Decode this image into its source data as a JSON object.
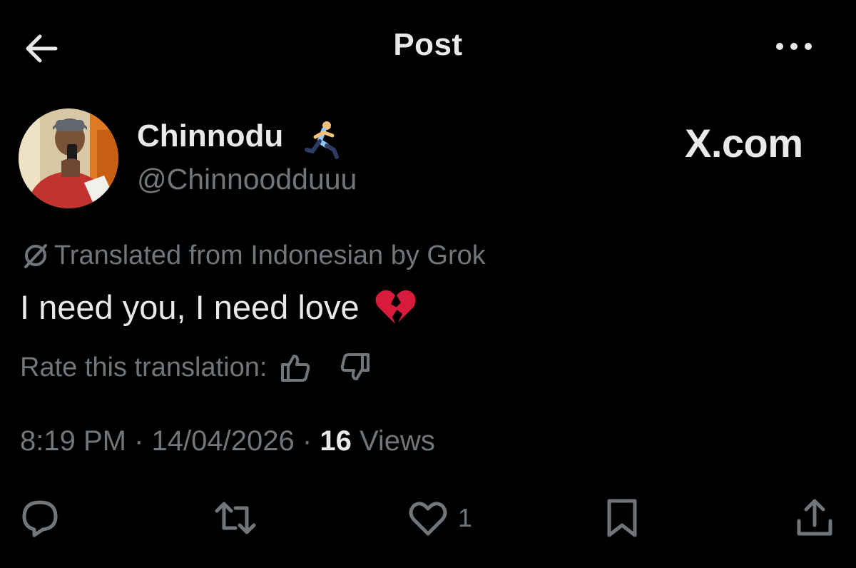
{
  "header": {
    "title": "Post",
    "back_icon": "arrow-left-icon",
    "more_icon": "more-horizontal-icon"
  },
  "author": {
    "display_name": "Chinnodu",
    "badge_emoji": "runner-emoji",
    "handle": "@Chinnoodduuu"
  },
  "watermark": "X.com",
  "translation": {
    "label": "Translated from Indonesian by Grok",
    "rate_label": "Rate this translation:"
  },
  "post": {
    "text": "I need you, I need love",
    "emoji": "broken-heart-emoji"
  },
  "meta": {
    "time": "8:19 PM",
    "separator": "·",
    "date": "14/04/2026",
    "views_count": "16",
    "views_label": "Views"
  },
  "actions": {
    "like_count": "1"
  },
  "colors": {
    "background": "#000000",
    "primary_text": "#e7e9ea",
    "secondary_text": "#71767b",
    "broken_heart": "#d81b3c"
  }
}
